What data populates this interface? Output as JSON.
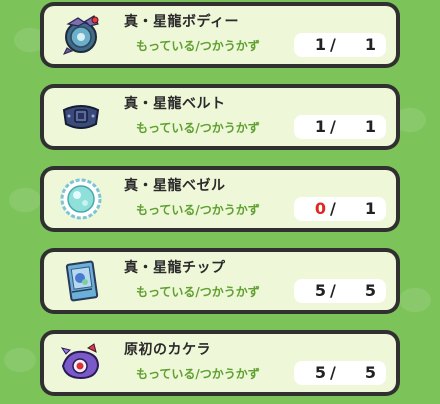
{
  "screen": {
    "background_color": "#7cc35a"
  },
  "materials": [
    {
      "name": "真・星龍ボディー",
      "owned_used_label": "もっている/つかうかず",
      "have": "1",
      "separator": "/",
      "need": "1",
      "icon": "dragon-body-orb-icon"
    },
    {
      "name": "真・星龍ベルト",
      "owned_used_label": "もっている/つかうかず",
      "have": "1",
      "separator": "/",
      "need": "1",
      "icon": "dragon-belt-icon"
    },
    {
      "name": "真・星龍ベゼル",
      "owned_used_label": "もっている/つかうかず",
      "have": "0",
      "separator": "/",
      "need": "1",
      "icon": "dragon-bezel-crystal-icon",
      "insufficient_color": "#e0261d"
    },
    {
      "name": "真・星龍チップ",
      "owned_used_label": "もっている/つかうかず",
      "have": "5",
      "separator": "/",
      "need": "5",
      "icon": "dragon-chip-card-icon"
    },
    {
      "name": "原初のカケラ",
      "owned_used_label": "もっている/つかうかず",
      "have": "5",
      "separator": "/",
      "need": "5",
      "icon": "primordial-fragment-icon"
    }
  ]
}
